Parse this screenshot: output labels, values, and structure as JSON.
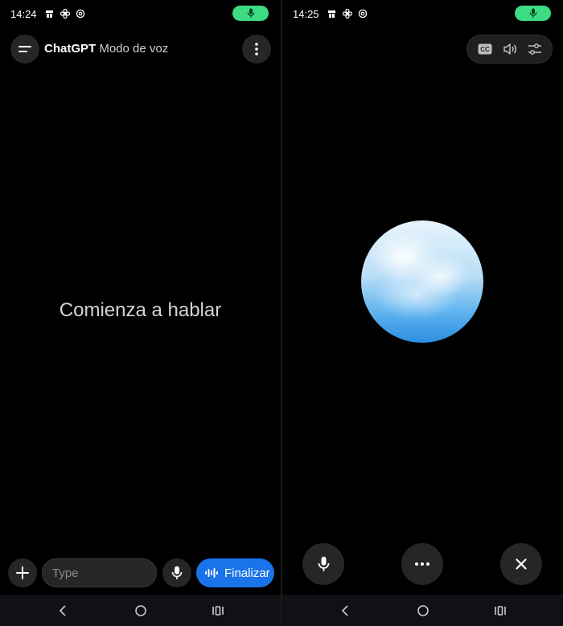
{
  "left": {
    "status": {
      "time": "14:24"
    },
    "header": {
      "app_name": "ChatGPT",
      "mode": "Modo de voz"
    },
    "prompt": "Comienza a hablar",
    "composer": {
      "placeholder": "Type",
      "finalize_label": "Finalizar"
    }
  },
  "right": {
    "status": {
      "time": "14:25"
    }
  },
  "colors": {
    "accent_blue": "#1a73e8",
    "mic_active_green": "#3ddc84",
    "background": "#000000"
  }
}
